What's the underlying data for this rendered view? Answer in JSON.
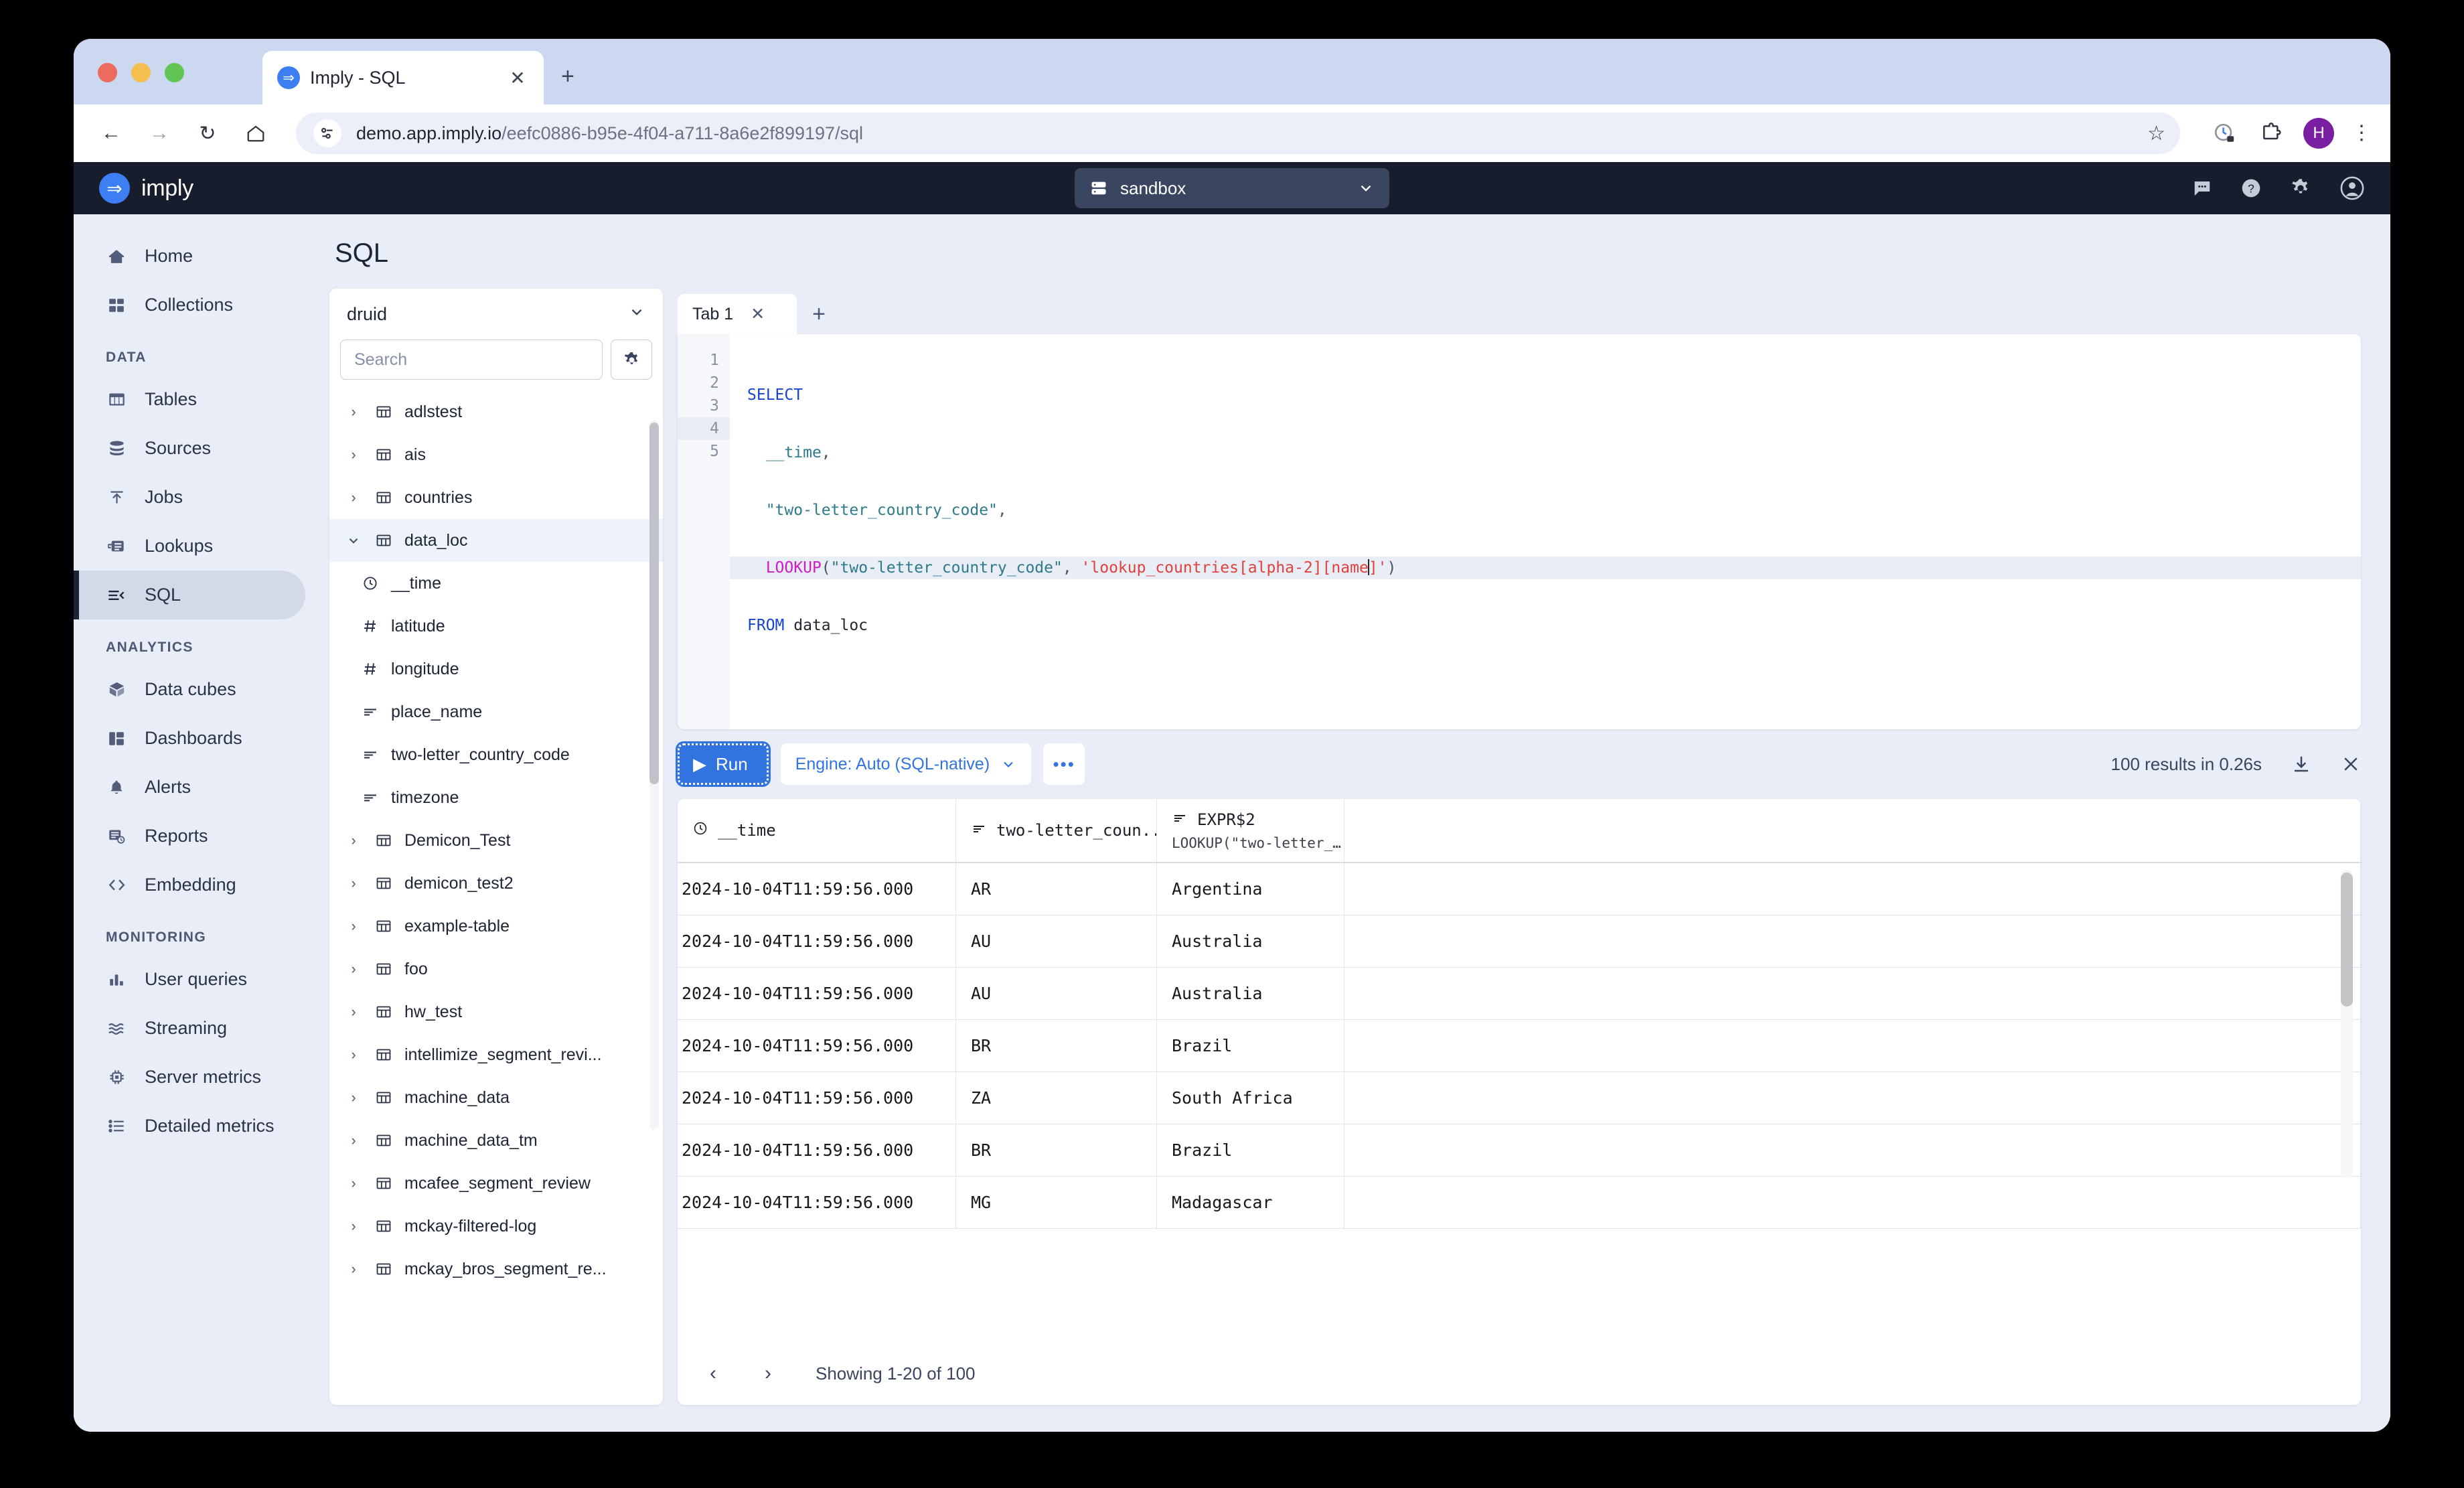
{
  "browser": {
    "tab_title": "Imply - SQL",
    "tab_favicon": "imply-arrow-icon",
    "url_host": "demo.app.imply.io",
    "url_path": "/eefc0886-b95e-4f04-a711-8a6e2f899197/sql",
    "profile_initial": "H"
  },
  "header": {
    "logo_text": "imply",
    "cluster": "sandbox"
  },
  "sidebar": {
    "items": [
      {
        "label": "Home",
        "icon": "home-icon",
        "section": null,
        "active": false
      },
      {
        "label": "Collections",
        "icon": "collections-icon",
        "section": null,
        "active": false
      }
    ],
    "sections": [
      {
        "title": "DATA",
        "items": [
          {
            "label": "Tables",
            "icon": "table-icon",
            "active": false
          },
          {
            "label": "Sources",
            "icon": "database-icon",
            "active": false
          },
          {
            "label": "Jobs",
            "icon": "upload-icon",
            "active": false
          },
          {
            "label": "Lookups",
            "icon": "lookup-icon",
            "active": false
          },
          {
            "label": "SQL",
            "icon": "sql-icon",
            "active": true
          }
        ]
      },
      {
        "title": "ANALYTICS",
        "items": [
          {
            "label": "Data cubes",
            "icon": "cube-icon",
            "active": false
          },
          {
            "label": "Dashboards",
            "icon": "dashboard-icon",
            "active": false
          },
          {
            "label": "Alerts",
            "icon": "bell-icon",
            "active": false
          },
          {
            "label": "Reports",
            "icon": "report-icon",
            "active": false
          },
          {
            "label": "Embedding",
            "icon": "code-brackets-icon",
            "active": false
          }
        ]
      },
      {
        "title": "MONITORING",
        "items": [
          {
            "label": "User queries",
            "icon": "bar-chart-icon",
            "active": false
          },
          {
            "label": "Streaming",
            "icon": "waves-icon",
            "active": false
          },
          {
            "label": "Server metrics",
            "icon": "chip-icon",
            "active": false
          },
          {
            "label": "Detailed metrics",
            "icon": "list-icon",
            "active": false
          }
        ]
      }
    ]
  },
  "page": {
    "title": "SQL"
  },
  "tree": {
    "schema": "druid",
    "search_placeholder": "Search",
    "search_value": "",
    "rows": [
      {
        "label": "adlstest",
        "type": "table",
        "expanded": false,
        "selected": false
      },
      {
        "label": "ais",
        "type": "table",
        "expanded": false,
        "selected": false
      },
      {
        "label": "countries",
        "type": "table",
        "expanded": false,
        "selected": false
      },
      {
        "label": "data_loc",
        "type": "table",
        "expanded": true,
        "selected": true
      },
      {
        "label": "__time",
        "type": "column",
        "coltype": "time"
      },
      {
        "label": "latitude",
        "type": "column",
        "coltype": "number"
      },
      {
        "label": "longitude",
        "type": "column",
        "coltype": "number"
      },
      {
        "label": "place_name",
        "type": "column",
        "coltype": "string"
      },
      {
        "label": "two-letter_country_code",
        "type": "column",
        "coltype": "string"
      },
      {
        "label": "timezone",
        "type": "column",
        "coltype": "string"
      },
      {
        "label": "Demicon_Test",
        "type": "table",
        "expanded": false,
        "selected": false
      },
      {
        "label": "demicon_test2",
        "type": "table",
        "expanded": false,
        "selected": false
      },
      {
        "label": "example-table",
        "type": "table",
        "expanded": false,
        "selected": false
      },
      {
        "label": "foo",
        "type": "table",
        "expanded": false,
        "selected": false
      },
      {
        "label": "hw_test",
        "type": "table",
        "expanded": false,
        "selected": false
      },
      {
        "label": "intellimize_segment_revi...",
        "type": "table",
        "expanded": false,
        "selected": false
      },
      {
        "label": "machine_data",
        "type": "table",
        "expanded": false,
        "selected": false
      },
      {
        "label": "machine_data_tm",
        "type": "table",
        "expanded": false,
        "selected": false
      },
      {
        "label": "mcafee_segment_review",
        "type": "table",
        "expanded": false,
        "selected": false
      },
      {
        "label": "mckay-filtered-log",
        "type": "table",
        "expanded": false,
        "selected": false
      },
      {
        "label": "mckay_bros_segment_re...",
        "type": "table",
        "expanded": false,
        "selected": false
      }
    ]
  },
  "editor": {
    "tabs": [
      {
        "label": "Tab 1",
        "active": true
      }
    ],
    "add_tab_label": "+",
    "line_numbers": [
      "1",
      "2",
      "3",
      "4",
      "5"
    ],
    "active_line": 4,
    "sql_lines": [
      "SELECT",
      "  __time,",
      "  \"two-letter_country_code\",",
      "  LOOKUP(\"two-letter_country_code\", 'lookup_countries[alpha-2][name]')",
      "FROM data_loc"
    ]
  },
  "toolbar": {
    "run_label": "Run",
    "engine_label": "Engine: Auto (SQL-native)",
    "more_label": "•••",
    "results_summary": "100 results in 0.26s",
    "download_icon": "download-icon",
    "close_icon": "close-icon"
  },
  "results": {
    "columns": [
      {
        "name": "__time",
        "icon": "clock-icon",
        "subtitle": ""
      },
      {
        "name": "two-letter_coun...",
        "icon": "string-icon",
        "subtitle": ""
      },
      {
        "name": "EXPR$2",
        "icon": "string-icon",
        "subtitle": "LOOKUP(\"two-letter_…"
      },
      {
        "name": "",
        "icon": "",
        "subtitle": ""
      }
    ],
    "rows": [
      {
        "time": "2024-10-04T11:59:56.000",
        "code": "AR",
        "country": "Argentina"
      },
      {
        "time": "2024-10-04T11:59:56.000",
        "code": "AU",
        "country": "Australia"
      },
      {
        "time": "2024-10-04T11:59:56.000",
        "code": "AU",
        "country": "Australia"
      },
      {
        "time": "2024-10-04T11:59:56.000",
        "code": "BR",
        "country": "Brazil"
      },
      {
        "time": "2024-10-04T11:59:56.000",
        "code": "ZA",
        "country": "South Africa"
      },
      {
        "time": "2024-10-04T11:59:56.000",
        "code": "BR",
        "country": "Brazil"
      },
      {
        "time": "2024-10-04T11:59:56.000",
        "code": "MG",
        "country": "Madagascar"
      }
    ],
    "pagination": {
      "prev": "‹",
      "next": "›",
      "label": "Showing 1-20 of 100"
    }
  },
  "colors": {
    "brand_blue": "#3d7ff2",
    "header_dark": "#171d2c",
    "app_bg": "#e9edf7",
    "accent_run": "#3174e0"
  }
}
